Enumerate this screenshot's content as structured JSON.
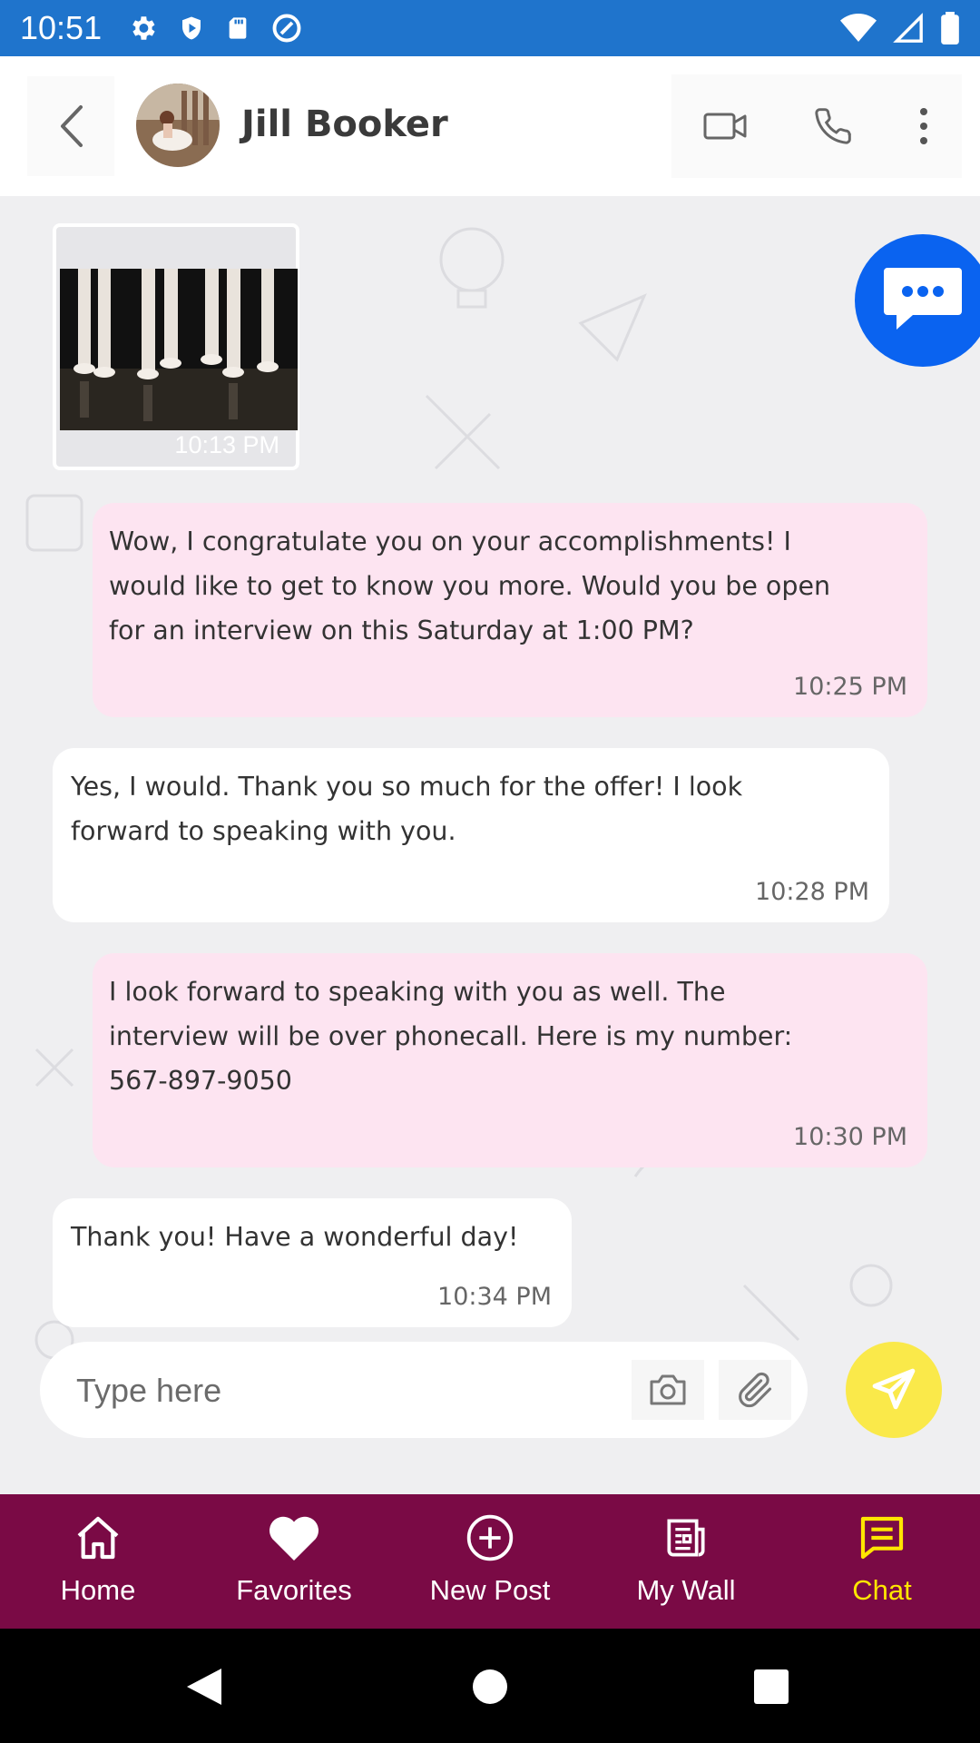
{
  "status_bar": {
    "time": "10:51"
  },
  "header": {
    "contact_name": "Jill Booker"
  },
  "messages": [
    {
      "type": "image",
      "direction": "incoming",
      "time": "10:13 PM"
    },
    {
      "type": "text",
      "direction": "outgoing",
      "lines": [
        "Wow, I congratulate you on your accomplishments! I",
        "would like to get to know you more. Would you be open",
        "for an interview on this Saturday at 1:00 PM?"
      ],
      "time": "10:25 PM"
    },
    {
      "type": "text",
      "direction": "incoming",
      "lines": [
        "Yes, I would. Thank you so much for the offer! I look",
        "forward to speaking with you."
      ],
      "time": "10:28 PM"
    },
    {
      "type": "text",
      "direction": "outgoing",
      "lines": [
        "I look forward to speaking with you as well. The",
        "interview will be over phonecall. Here is my number:",
        "567-897-9050"
      ],
      "time": "10:30 PM"
    },
    {
      "type": "text",
      "direction": "incoming",
      "lines": [
        "Thank you! Have a wonderful day!"
      ],
      "time": "10:34 PM"
    }
  ],
  "composer": {
    "placeholder": "Type here"
  },
  "bottom_nav": [
    {
      "label": "Home",
      "icon": "home-icon",
      "active": false
    },
    {
      "label": "Favorites",
      "icon": "heart-icon",
      "active": false
    },
    {
      "label": "New Post",
      "icon": "plus-circle-icon",
      "active": false
    },
    {
      "label": "My Wall",
      "icon": "newspaper-icon",
      "active": false
    },
    {
      "label": "Chat",
      "icon": "chat-icon",
      "active": true
    }
  ],
  "colors": {
    "status_bar": "#1f74cc",
    "nav_background": "#7a0a45",
    "nav_active": "#ffe600",
    "outgoing_bubble": "#fde4f1",
    "send_button": "#fae94a",
    "fab": "#0a63f0"
  }
}
